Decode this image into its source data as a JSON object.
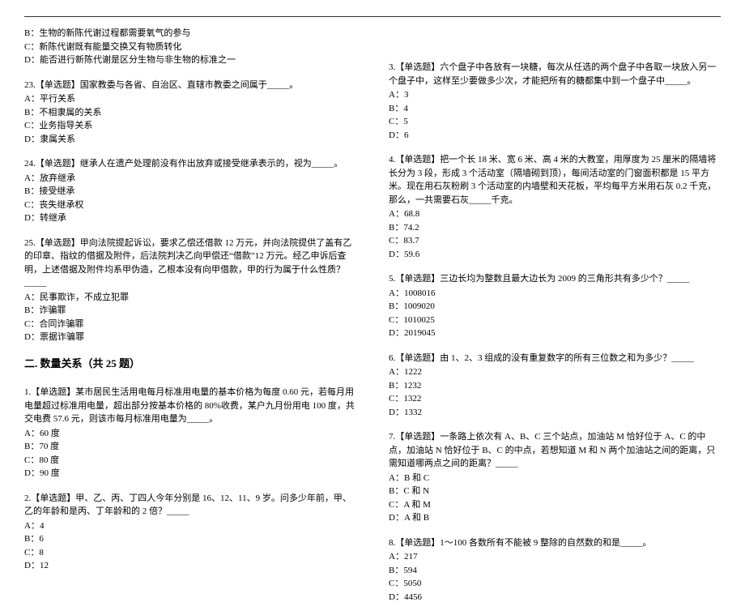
{
  "left": {
    "q22_opts": {
      "b": "B：生物的新陈代谢过程都需要氧气的参与",
      "c": "C：新陈代谢既有能量交换又有物质转化",
      "d": "D：能否进行新陈代谢是区分生物与非生物的标准之一"
    },
    "q23": {
      "stem": "23.【单选题】国家教委与各省、自治区、直辖市教委之间属于_____。",
      "a": "A：平行关系",
      "b": "B：不相隶属的关系",
      "c": "C：业务指导关系",
      "d": "D：隶属关系"
    },
    "q24": {
      "stem": "24.【单选题】继承人在遗产处理前没有作出放弃或接受继承表示的，视为_____。",
      "a": "A：放弃继承",
      "b": "B：接受继承",
      "c": "C：丧失继承权",
      "d": "D：转继承"
    },
    "q25": {
      "stem": "25.【单选题】甲向法院提起诉讼，要求乙偿还借款 12 万元，并向法院提供了盖有乙的印章、指纹的借据及附件，后法院判决乙向甲偿还“借款”12 万元。经乙申诉后查明，上述借据及附件均系甲伪造，乙根本没有向甲借款，甲的行为属于什么性质？_____",
      "a": "A：民事欺诈，不成立犯罪",
      "b": "B：诈骗罪",
      "c": "C：合同诈骗罪",
      "d": "D：票据诈骗罪"
    },
    "section2_title": "二. 数量关系（共 25 题）",
    "s2q1": {
      "stem": "1.【单选题】某市居民生活用电每月标准用电量的基本价格为每度 0.60 元，若每月用电量超过标准用电量，超出部分按基本价格的 80%收费，某户九月份用电 100 度，共交电费 57.6 元，则该市每月标准用电量为_____。",
      "a": "A：60 度",
      "b": "B：70 度",
      "c": "C：80 度",
      "d": "D：90 度"
    },
    "s2q2": {
      "stem": "2.【单选题】甲、乙、丙、丁四人今年分别是 16、12、11、9 岁。问多少年前，甲、乙的年龄和是丙、丁年龄和的 2 倍？_____",
      "a": "A：4",
      "b": "B：6",
      "c": "C：8",
      "d": "D：12"
    }
  },
  "right": {
    "s2q3": {
      "stem": "3.【单选题】六个盘子中各放有一块糖，每次从任选的两个盘子中各取一块放入另一个盘子中，这样至少要做多少次，才能把所有的糖都集中到一个盘子中_____。",
      "a": "A：3",
      "b": "B：4",
      "c": "C：5",
      "d": "D：6"
    },
    "s2q4": {
      "stem": "4.【单选题】把一个长 18 米、宽 6 米、高 4 米的大教室，用厚度为 25 厘米的隔墙将长分为 3 段，形成 3 个活动室（隔墙砌到顶），每间活动室的门窗面积都是 15 平方米。现在用石灰粉刷 3 个活动室的内墙壁和天花板，平均每平方米用石灰 0.2 千克，那么，一共需要石灰_____千克。",
      "a": "A：68.8",
      "b": "B：74.2",
      "c": "C：83.7",
      "d": "D：59.6"
    },
    "s2q5": {
      "stem": "5.【单选题】三边长均为整数且最大边长为 2009 的三角形共有多少个？_____",
      "a": "A：1008016",
      "b": "B：1009020",
      "c": "C：1010025",
      "d": "D：2019045"
    },
    "s2q6": {
      "stem": "6.【单选题】由 1、2、3 组成的没有重复数字的所有三位数之和为多少？_____",
      "a": "A：1222",
      "b": "B：1232",
      "c": "C：1322",
      "d": "D：1332"
    },
    "s2q7": {
      "stem": "7.【单选题】一条路上依次有 A、B、C 三个站点，加油站 M 恰好位于 A、C 的中点，加油站 N 恰好位于 B、C 的中点，若想知道 M 和 N 两个加油站之间的距离，只需知道哪两点之间的距离？_____",
      "a": "A：B 和 C",
      "b": "B：C 和 N",
      "c": "C：A 和 M",
      "d": "D：A 和 B"
    },
    "s2q8": {
      "stem": "8.【单选题】1～100 各数所有不能被 9 整除的自然数的和是_____。",
      "a": "A：217",
      "b": "B：594",
      "c": "C：5050",
      "d": "D：4456"
    }
  }
}
